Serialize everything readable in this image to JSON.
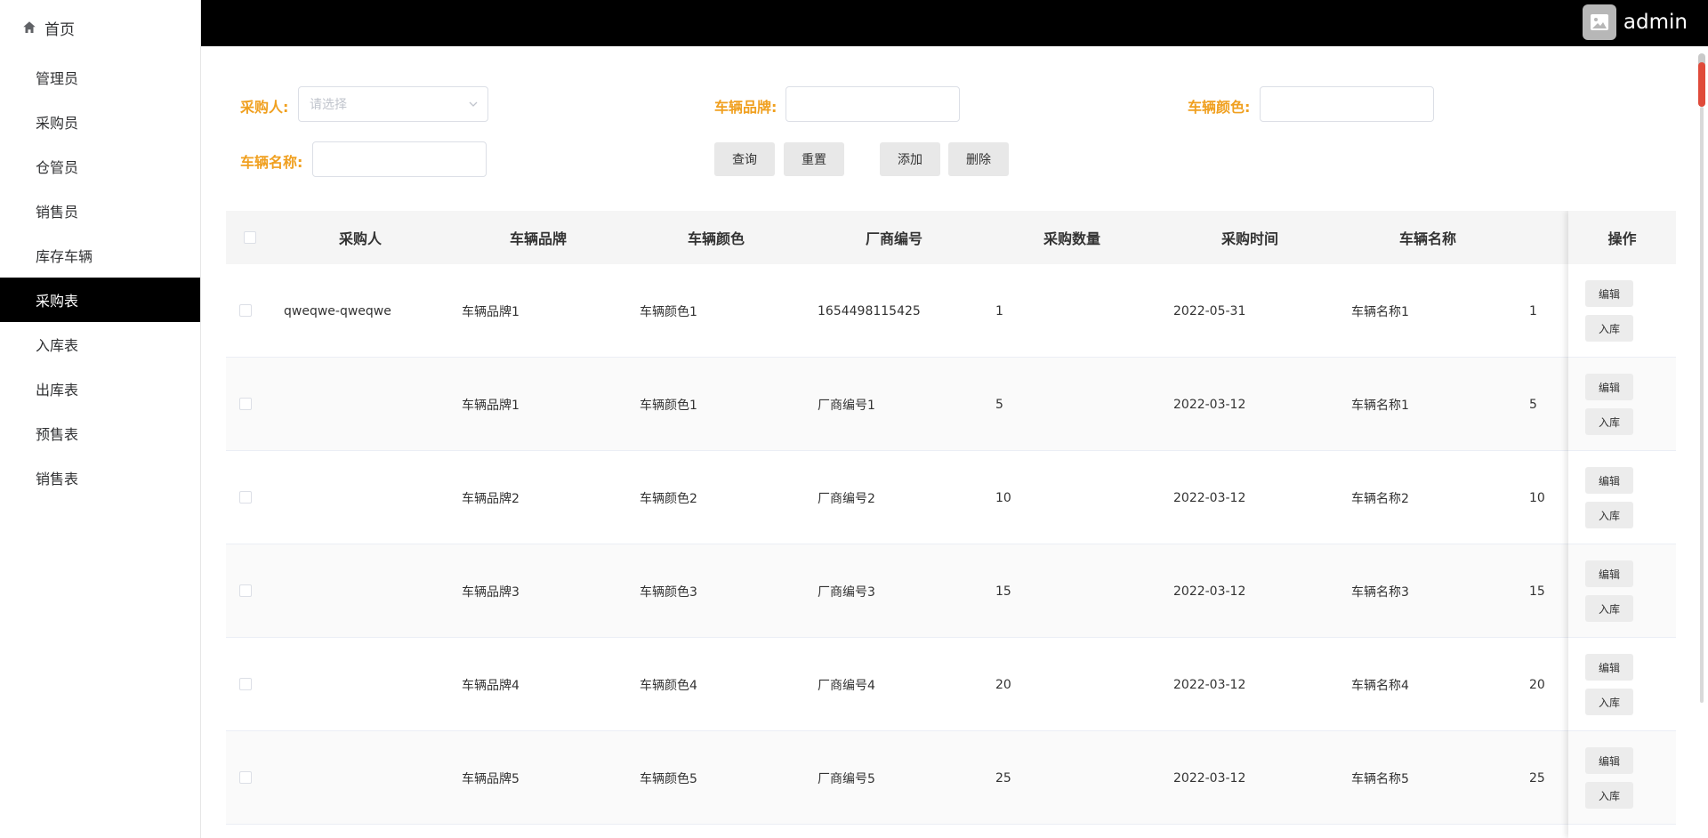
{
  "sidebar": {
    "home": "首页",
    "items": [
      {
        "label": "管理员"
      },
      {
        "label": "采购员"
      },
      {
        "label": "仓管员"
      },
      {
        "label": "销售员"
      },
      {
        "label": "库存车辆"
      },
      {
        "label": "采购表",
        "active": true
      },
      {
        "label": "入库表"
      },
      {
        "label": "出库表"
      },
      {
        "label": "预售表"
      },
      {
        "label": "销售表"
      }
    ]
  },
  "topbar": {
    "username": "admin"
  },
  "search": {
    "buyer_label": "采购人:",
    "buyer_placeholder": "请选择",
    "brand_label": "车辆品牌:",
    "brand_value": "",
    "color_label": "车辆颜色:",
    "color_value": "",
    "name_label": "车辆名称:",
    "name_value": "",
    "query_btn": "查询",
    "reset_btn": "重置",
    "add_btn": "添加",
    "delete_btn": "删除"
  },
  "table": {
    "headers": {
      "buyer": "采购人",
      "brand": "车辆品牌",
      "color": "车辆颜色",
      "vendor": "厂商编号",
      "qty": "采购数量",
      "time": "采购时间",
      "name": "车辆名称",
      "ops": "操作"
    },
    "edit_label": "编辑",
    "stock_label": "入库",
    "rows": [
      {
        "buyer": "qweqwe-qweqwe",
        "brand": "车辆品牌1",
        "color": "车辆颜色1",
        "vendor": "1654498115425",
        "qty": "1",
        "time": "2022-05-31",
        "name": "车辆名称1",
        "extra": "1"
      },
      {
        "buyer": "",
        "brand": "车辆品牌1",
        "color": "车辆颜色1",
        "vendor": "厂商编号1",
        "qty": "5",
        "time": "2022-03-12",
        "name": "车辆名称1",
        "extra": "5"
      },
      {
        "buyer": "",
        "brand": "车辆品牌2",
        "color": "车辆颜色2",
        "vendor": "厂商编号2",
        "qty": "10",
        "time": "2022-03-12",
        "name": "车辆名称2",
        "extra": "10"
      },
      {
        "buyer": "",
        "brand": "车辆品牌3",
        "color": "车辆颜色3",
        "vendor": "厂商编号3",
        "qty": "15",
        "time": "2022-03-12",
        "name": "车辆名称3",
        "extra": "15"
      },
      {
        "buyer": "",
        "brand": "车辆品牌4",
        "color": "车辆颜色4",
        "vendor": "厂商编号4",
        "qty": "20",
        "time": "2022-03-12",
        "name": "车辆名称4",
        "extra": "20"
      },
      {
        "buyer": "",
        "brand": "车辆品牌5",
        "color": "车辆颜色5",
        "vendor": "厂商编号5",
        "qty": "25",
        "time": "2022-03-12",
        "name": "车辆名称5",
        "extra": "25"
      }
    ]
  }
}
